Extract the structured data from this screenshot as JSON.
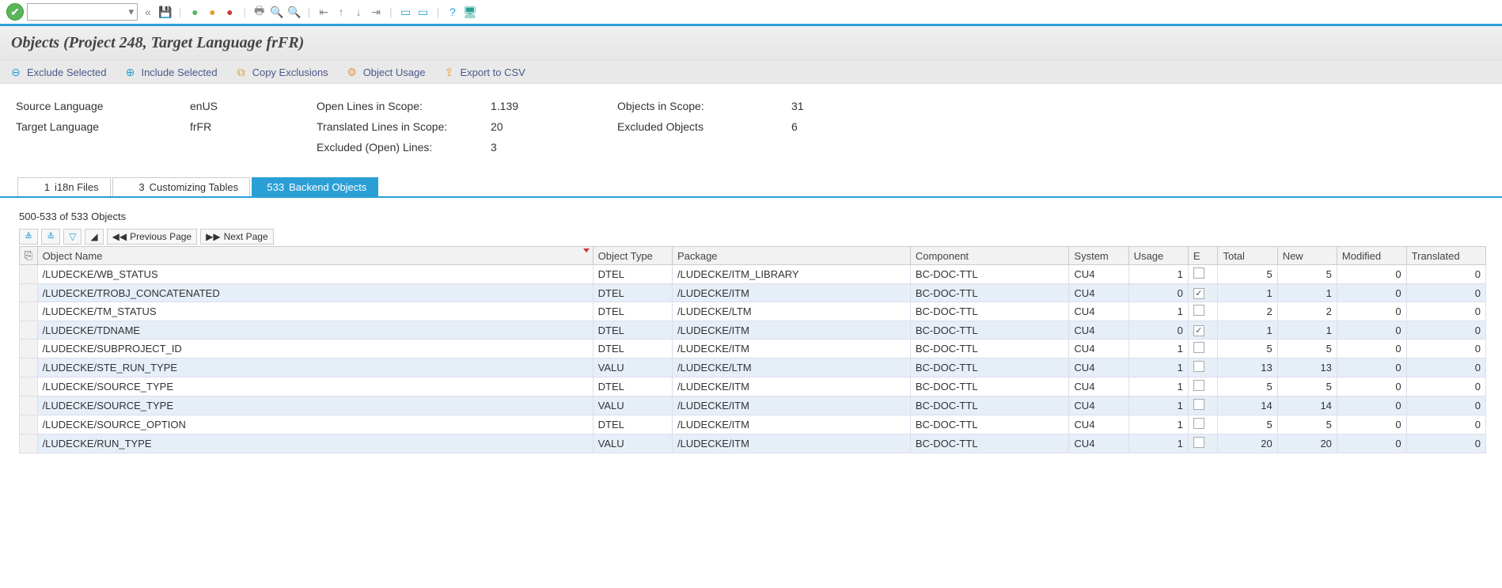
{
  "title": "Objects (Project 248, Target Language frFR)",
  "actions": {
    "exclude": "Exclude Selected",
    "include": "Include Selected",
    "copy": "Copy Exclusions",
    "usage": "Object Usage",
    "export": "Export to CSV"
  },
  "info": {
    "srcLangLabel": "Source Language",
    "srcLang": "enUS",
    "tgtLangLabel": "Target Language",
    "tgtLang": "frFR",
    "openLinesLabel": "Open Lines in Scope:",
    "openLines": "1.139",
    "transLinesLabel": "Translated Lines in Scope:",
    "transLines": "20",
    "exclLinesLabel": "Excluded (Open) Lines:",
    "exclLines": "3",
    "objsScopeLabel": "Objects in Scope:",
    "objsScope": "31",
    "exclObjsLabel": "Excluded Objects",
    "exclObjs": "6"
  },
  "tabs": [
    {
      "count": "1",
      "label": "i18n Files",
      "active": false
    },
    {
      "count": "3",
      "label": "Customizing Tables",
      "active": false
    },
    {
      "count": "533",
      "label": "Backend Objects",
      "active": true
    }
  ],
  "grid": {
    "rangeText": "500-533 of 533 Objects",
    "prev": "Previous Page",
    "next": "Next Page",
    "headers": {
      "name": "Object Name",
      "type": "Object Type",
      "pkg": "Package",
      "comp": "Component",
      "sys": "System",
      "usage": "Usage",
      "e": "E",
      "total": "Total",
      "new": "New",
      "mod": "Modified",
      "tr": "Translated"
    },
    "rows": [
      {
        "name": "/LUDECKE/WB_STATUS",
        "type": "DTEL",
        "pkg": "/LUDECKE/ITM_LIBRARY",
        "comp": "BC-DOC-TTL",
        "sys": "CU4",
        "usage": 1,
        "e": false,
        "total": 5,
        "new": 5,
        "mod": 0,
        "tr": 0
      },
      {
        "name": "/LUDECKE/TROBJ_CONCATENATED",
        "type": "DTEL",
        "pkg": "/LUDECKE/ITM",
        "comp": "BC-DOC-TTL",
        "sys": "CU4",
        "usage": 0,
        "e": true,
        "total": 1,
        "new": 1,
        "mod": 0,
        "tr": 0
      },
      {
        "name": "/LUDECKE/TM_STATUS",
        "type": "DTEL",
        "pkg": "/LUDECKE/LTM",
        "comp": "BC-DOC-TTL",
        "sys": "CU4",
        "usage": 1,
        "e": false,
        "total": 2,
        "new": 2,
        "mod": 0,
        "tr": 0
      },
      {
        "name": "/LUDECKE/TDNAME",
        "type": "DTEL",
        "pkg": "/LUDECKE/ITM",
        "comp": "BC-DOC-TTL",
        "sys": "CU4",
        "usage": 0,
        "e": true,
        "total": 1,
        "new": 1,
        "mod": 0,
        "tr": 0
      },
      {
        "name": "/LUDECKE/SUBPROJECT_ID",
        "type": "DTEL",
        "pkg": "/LUDECKE/ITM",
        "comp": "BC-DOC-TTL",
        "sys": "CU4",
        "usage": 1,
        "e": false,
        "total": 5,
        "new": 5,
        "mod": 0,
        "tr": 0
      },
      {
        "name": "/LUDECKE/STE_RUN_TYPE",
        "type": "VALU",
        "pkg": "/LUDECKE/LTM",
        "comp": "BC-DOC-TTL",
        "sys": "CU4",
        "usage": 1,
        "e": false,
        "total": 13,
        "new": 13,
        "mod": 0,
        "tr": 0
      },
      {
        "name": "/LUDECKE/SOURCE_TYPE",
        "type": "DTEL",
        "pkg": "/LUDECKE/ITM",
        "comp": "BC-DOC-TTL",
        "sys": "CU4",
        "usage": 1,
        "e": false,
        "total": 5,
        "new": 5,
        "mod": 0,
        "tr": 0
      },
      {
        "name": "/LUDECKE/SOURCE_TYPE",
        "type": "VALU",
        "pkg": "/LUDECKE/ITM",
        "comp": "BC-DOC-TTL",
        "sys": "CU4",
        "usage": 1,
        "e": false,
        "total": 14,
        "new": 14,
        "mod": 0,
        "tr": 0
      },
      {
        "name": "/LUDECKE/SOURCE_OPTION",
        "type": "DTEL",
        "pkg": "/LUDECKE/ITM",
        "comp": "BC-DOC-TTL",
        "sys": "CU4",
        "usage": 1,
        "e": false,
        "total": 5,
        "new": 5,
        "mod": 0,
        "tr": 0
      },
      {
        "name": "/LUDECKE/RUN_TYPE",
        "type": "VALU",
        "pkg": "/LUDECKE/ITM",
        "comp": "BC-DOC-TTL",
        "sys": "CU4",
        "usage": 1,
        "e": false,
        "total": 20,
        "new": 20,
        "mod": 0,
        "tr": 0
      }
    ]
  }
}
